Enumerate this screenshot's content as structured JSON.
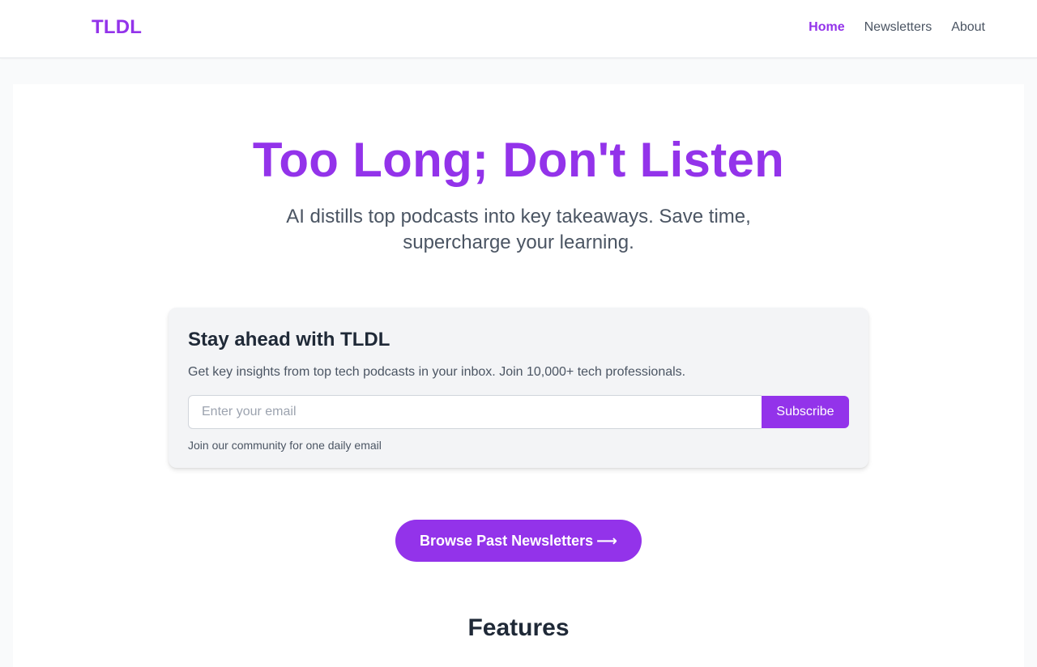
{
  "header": {
    "brand": "TLDL",
    "nav": [
      {
        "label": "Home",
        "active": true
      },
      {
        "label": "Newsletters",
        "active": false
      },
      {
        "label": "About",
        "active": false
      }
    ]
  },
  "hero": {
    "title": "Too Long; Don't Listen",
    "subtitle_line1": "AI distills top podcasts into key takeaways. Save time,",
    "subtitle_line2": "supercharge your learning."
  },
  "subscribe": {
    "title": "Stay ahead with TLDL",
    "description": "Get key insights from top tech podcasts in your inbox. Join 10,000+ tech professionals.",
    "email_placeholder": "Enter your email",
    "email_value": "",
    "button_label": "Subscribe",
    "note": "Join our community for one daily email"
  },
  "browse": {
    "label": "Browse Past Newsletters",
    "icon": "arrow-right-icon",
    "icon_glyph": "⟶"
  },
  "features": {
    "title": "Features"
  },
  "colors": {
    "accent": "#9333ea",
    "text_dark": "#1f2937",
    "text_muted": "#4b5563",
    "page_bg": "#f9fafb",
    "card_bg": "#ffffff",
    "panel_bg": "#f3f4f6"
  }
}
